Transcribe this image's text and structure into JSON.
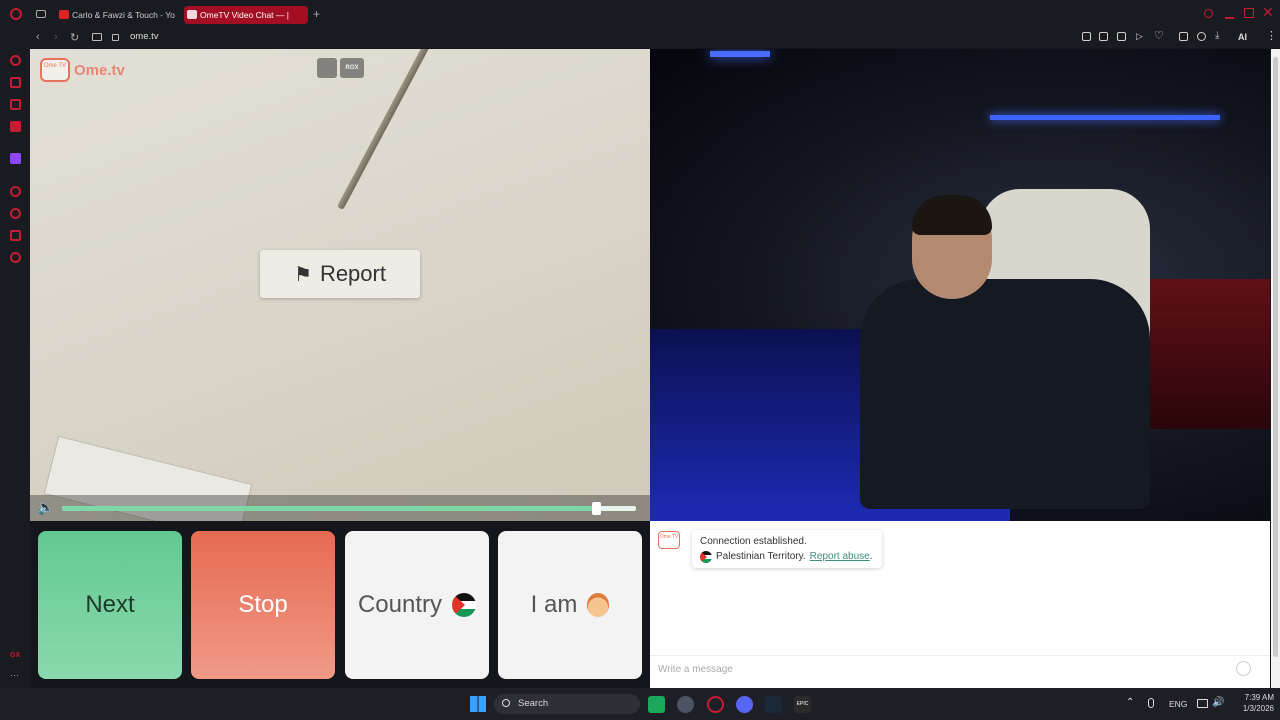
{
  "browser": {
    "tabs": [
      {
        "title": "Carlo & Fawzi & Touch - Yo",
        "active": false,
        "favicon_color": "#e02424"
      },
      {
        "title": "OmeTV Video Chat — |",
        "active": true,
        "favicon_color": "#e94050"
      }
    ],
    "new_tab_label": "+",
    "url": "ome.tv",
    "ai_label": "AI",
    "accent_color": "#c51c33"
  },
  "sidebar": {
    "items": [
      "opera-icon",
      "refresh-icon",
      "bag-icon",
      "chat-icon",
      "messenger-icon",
      "twitch-icon",
      "play-icon",
      "clock-icon",
      "box-icon",
      "settings-icon"
    ],
    "gx_label": "GX",
    "more_label": "···"
  },
  "ometv": {
    "logo_text": "Ome.tv",
    "logo_badge": "Ome TV",
    "rgx_label": "RGX",
    "report_label": "Report",
    "volume_level": 0.93,
    "buttons": {
      "next": "Next",
      "stop": "Stop",
      "country": "Country",
      "iam": "I am"
    },
    "chat": {
      "connection": "Connection established.",
      "location": "Palestinian Territory.",
      "report_abuse": "Report abuse",
      "period": ".",
      "placeholder": "Write a message"
    },
    "colors": {
      "next": "#6fcf97",
      "stop": "#e8725e",
      "link": "#3f8f80"
    }
  },
  "taskbar": {
    "search_label": "Search",
    "lang": "ENG",
    "time": "7:39 AM",
    "date": "1/3/2026",
    "epic_label": "EPIC"
  }
}
